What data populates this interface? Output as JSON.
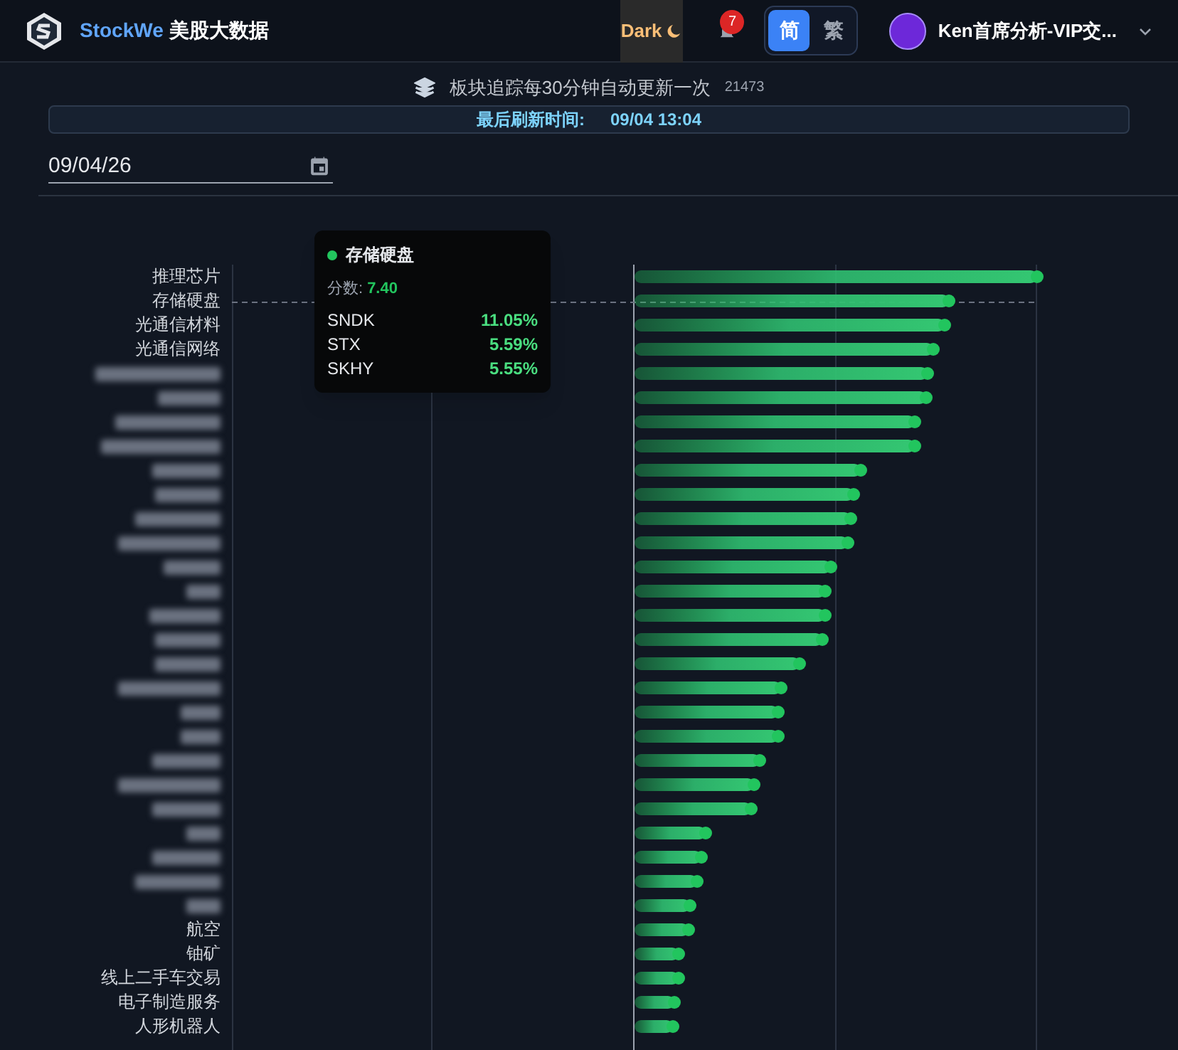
{
  "header": {
    "brand": "StockWe",
    "title": "美股大数据",
    "theme_toggle": "Dark",
    "notification_count": "7",
    "languages": [
      {
        "label": "简",
        "selected": true
      },
      {
        "label": "繁",
        "selected": false
      }
    ],
    "user_name": "Ken首席分析-VIP交..."
  },
  "info": {
    "text": "板块追踪每30分钟自动更新一次",
    "count": "21473"
  },
  "refresh": {
    "label": "最后刷新时间:",
    "time": "09/04 13:04"
  },
  "date_field": {
    "value": "09/04/26"
  },
  "chart": {
    "top_labels": [
      "推理芯片",
      "存储硬盘",
      "光通信材料",
      "光通信网络"
    ],
    "bottom_labels": [
      "航空",
      "铀矿",
      "线上二手车交易",
      "电子制造服务",
      "人形机器人"
    ]
  },
  "tooltip": {
    "title": "存储硬盘",
    "score_label": "分数:",
    "score": "7.40",
    "stocks": [
      {
        "symbol": "SNDK",
        "change": "11.05%"
      },
      {
        "symbol": "STX",
        "change": "5.59%"
      },
      {
        "symbol": "SKHY",
        "change": "5.55%"
      }
    ]
  }
}
